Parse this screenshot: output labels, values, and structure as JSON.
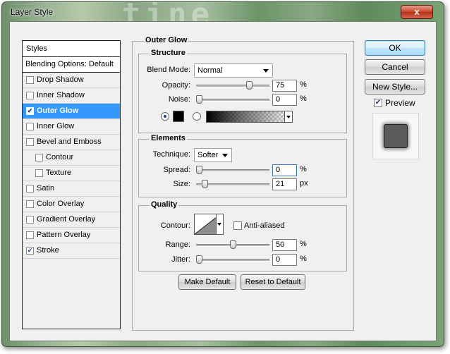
{
  "window": {
    "title": "Layer Style",
    "close_glyph": "x"
  },
  "styles_list": {
    "header": "Styles",
    "blending": "Blending Options: Default",
    "items": [
      {
        "label": "Drop Shadow",
        "checked": false,
        "sub": false,
        "selected": false
      },
      {
        "label": "Inner Shadow",
        "checked": false,
        "sub": false,
        "selected": false
      },
      {
        "label": "Outer Glow",
        "checked": true,
        "sub": false,
        "selected": true
      },
      {
        "label": "Inner Glow",
        "checked": false,
        "sub": false,
        "selected": false
      },
      {
        "label": "Bevel and Emboss",
        "checked": false,
        "sub": false,
        "selected": false
      },
      {
        "label": "Contour",
        "checked": false,
        "sub": true,
        "selected": false
      },
      {
        "label": "Texture",
        "checked": false,
        "sub": true,
        "selected": false
      },
      {
        "label": "Satin",
        "checked": false,
        "sub": false,
        "selected": false
      },
      {
        "label": "Color Overlay",
        "checked": false,
        "sub": false,
        "selected": false
      },
      {
        "label": "Gradient Overlay",
        "checked": false,
        "sub": false,
        "selected": false
      },
      {
        "label": "Pattern Overlay",
        "checked": false,
        "sub": false,
        "selected": false
      },
      {
        "label": "Stroke",
        "checked": true,
        "sub": false,
        "selected": false
      }
    ]
  },
  "outer_glow": {
    "title": "Outer Glow",
    "structure": {
      "title": "Structure",
      "blend_mode_label": "Blend Mode:",
      "blend_mode_value": "Normal",
      "opacity_label": "Opacity:",
      "opacity_value": "75",
      "opacity_unit": "%",
      "opacity_fraction": 0.75,
      "noise_label": "Noise:",
      "noise_value": "0",
      "noise_unit": "%",
      "noise_fraction": 0.0,
      "color_mode": "solid",
      "color": "#000000"
    },
    "elements": {
      "title": "Elements",
      "technique_label": "Technique:",
      "technique_value": "Softer",
      "spread_label": "Spread:",
      "spread_value": "0",
      "spread_unit": "%",
      "spread_fraction": 0.0,
      "size_label": "Size:",
      "size_value": "21",
      "size_unit": "px",
      "size_fraction": 0.08
    },
    "quality": {
      "title": "Quality",
      "contour_label": "Contour:",
      "anti_aliased_label": "Anti-aliased",
      "anti_aliased": false,
      "range_label": "Range:",
      "range_value": "50",
      "range_unit": "%",
      "range_fraction": 0.5,
      "jitter_label": "Jitter:",
      "jitter_value": "0",
      "jitter_unit": "%",
      "jitter_fraction": 0.0
    },
    "make_default": "Make Default",
    "reset_default": "Reset to Default"
  },
  "buttons": {
    "ok": "OK",
    "cancel": "Cancel",
    "new_style": "New Style...",
    "preview_label": "Preview",
    "preview_checked": true
  },
  "colors": {
    "selection": "#3399ff",
    "glow_color": "#000000"
  }
}
